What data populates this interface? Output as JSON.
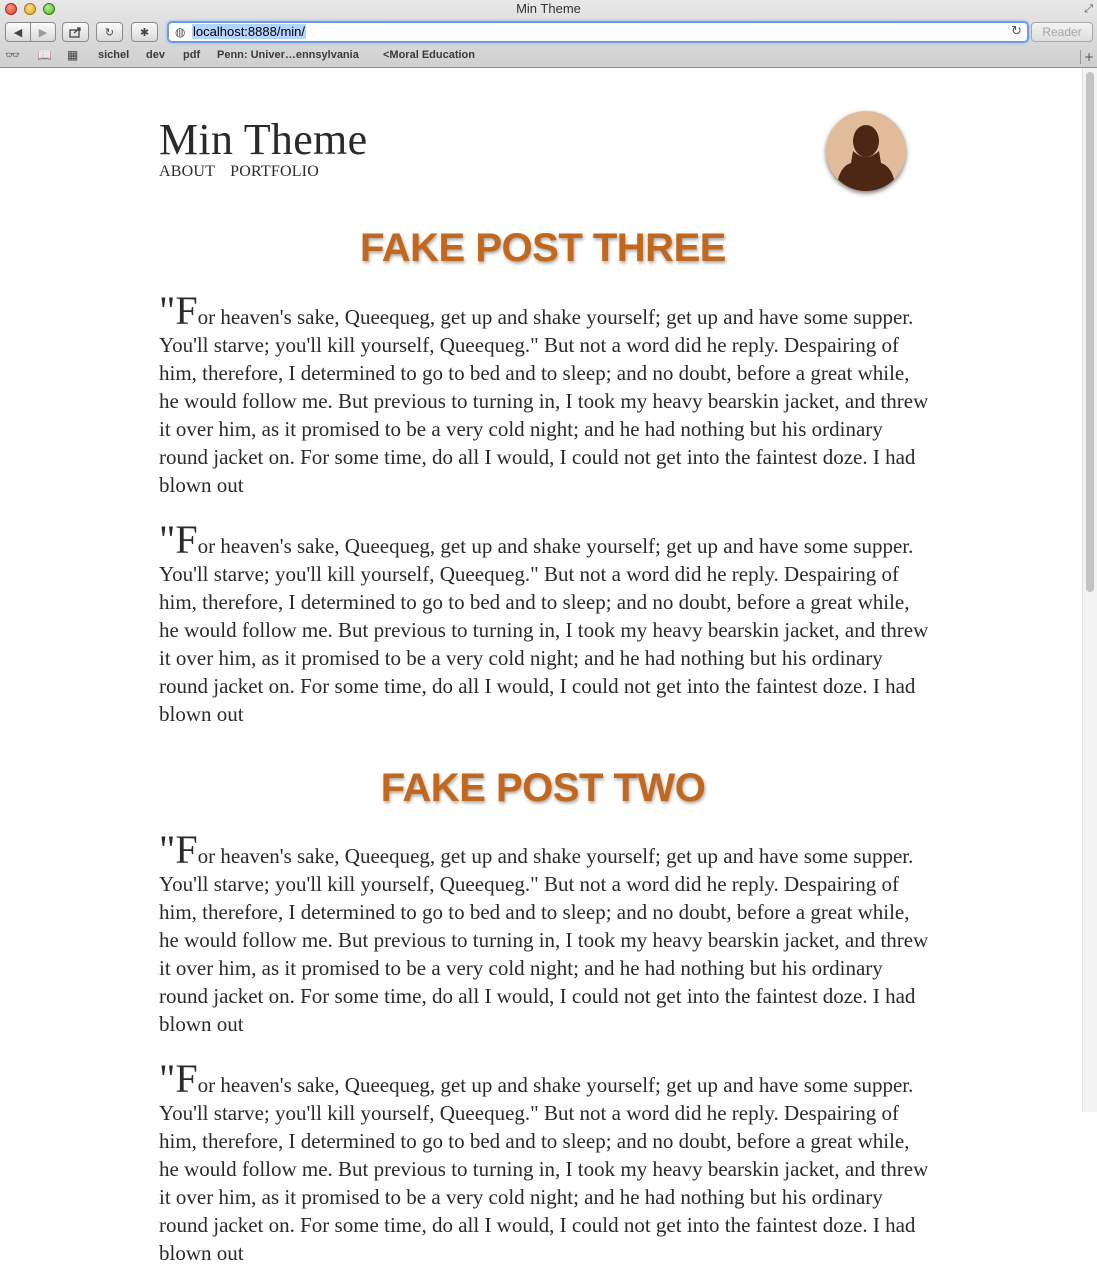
{
  "window": {
    "title": "Min Theme",
    "url": "localhost:8888/min/",
    "reader_label": "Reader"
  },
  "bookmarks": [
    "sichel",
    "dev",
    "pdf",
    "Penn: Univer…ennsylvania",
    "<Moral Education"
  ],
  "icons": {
    "back": "back-arrow-icon",
    "forward": "forward-arrow-icon",
    "share": "share-icon",
    "reload": "reload-icon",
    "extension": "extension-icon",
    "reading_list": "reading-list-icon",
    "bookmarks": "bookmarks-book-icon",
    "top_sites": "top-sites-grid-icon"
  },
  "site": {
    "title": "Min Theme",
    "nav": [
      "ABOUT",
      "PORTFOLIO"
    ]
  },
  "colors": {
    "post_title": "#c2671e",
    "avatar_bg": "#e2bc9a",
    "avatar_silhouette": "#4e2714"
  },
  "posts": [
    {
      "title": "FAKE POST THREE",
      "paragraphs": [
        {
          "lead": "\"F",
          "rest": "or heaven's sake, Queequeg, get up and shake yourself; get up and have some supper. You'll starve; you'll kill yourself, Queequeg.\" But not a word did he reply. Despairing of him, therefore, I determined to go to bed and to sleep; and no doubt, before a great while, he would follow me. But previous to turning in, I took my heavy bearskin jacket, and threw it over him, as it promised to be a very cold night; and he had nothing but his ordinary round jacket on. For some time, do all I would, I could not get into the faintest doze. I had blown out"
        },
        {
          "lead": "\"F",
          "rest": "or heaven's sake, Queequeg, get up and shake yourself; get up and have some supper. You'll starve; you'll kill yourself, Queequeg.\" But not a word did he reply. Despairing of him, therefore, I determined to go to bed and to sleep; and no doubt, before a great while, he would follow me. But previous to turning in, I took my heavy bearskin jacket, and threw it over him, as it promised to be a very cold night; and he had nothing but his ordinary round jacket on. For some time, do all I would, I could not get into the faintest doze. I had blown out"
        }
      ]
    },
    {
      "title": "FAKE POST TWO",
      "paragraphs": [
        {
          "lead": "\"F",
          "rest": "or heaven's sake, Queequeg, get up and shake yourself; get up and have some supper. You'll starve; you'll kill yourself, Queequeg.\" But not a word did he reply. Despairing of him, therefore, I determined to go to bed and to sleep; and no doubt, before a great while, he would follow me. But previous to turning in, I took my heavy bearskin jacket, and threw it over him, as it promised to be a very cold night; and he had nothing but his ordinary round jacket on. For some time, do all I would, I could not get into the faintest doze. I had blown out"
        },
        {
          "lead": "\"F",
          "rest": "or heaven's sake, Queequeg, get up and shake yourself; get up and have some supper. You'll starve; you'll kill yourself, Queequeg.\" But not a word did he reply. Despairing of him, therefore, I determined to go to bed and to sleep; and no doubt, before a great while, he would follow me. But previous to turning in, I took my heavy bearskin jacket, and threw it over him, as it promised to be a very cold night; and he had nothing but his ordinary round jacket on. For some time, do all I would, I could not get into the faintest doze. I had blown out"
        }
      ]
    }
  ]
}
